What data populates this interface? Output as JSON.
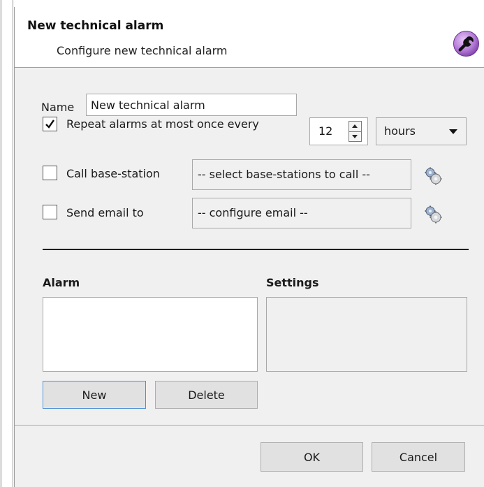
{
  "dialog": {
    "title": "New technical alarm",
    "subtitle": "Configure new technical alarm",
    "header_icon": "wrench-icon"
  },
  "form": {
    "name_label": "Name",
    "name_value": "New technical alarm",
    "repeat": {
      "checked": true,
      "label": "Repeat alarms at most once every",
      "interval_value": "12",
      "unit_value": "hours"
    },
    "call_base_station": {
      "checked": false,
      "label": "Call base-station",
      "field_text": "-- select base-stations to call --",
      "config_icon": "gears-icon"
    },
    "send_email": {
      "checked": false,
      "label": "Send email to",
      "field_text": "-- configure email --",
      "config_icon": "gears-icon"
    }
  },
  "alarm_section": {
    "title": "Alarm",
    "new_label": "New",
    "delete_label": "Delete"
  },
  "settings_section": {
    "title": "Settings"
  },
  "footer": {
    "ok_label": "OK",
    "cancel_label": "Cancel"
  },
  "colors": {
    "dialog_bg": "#f0f0f0",
    "wrench_bg": "#b57bd9",
    "default_button_border": "#4a90d9"
  }
}
